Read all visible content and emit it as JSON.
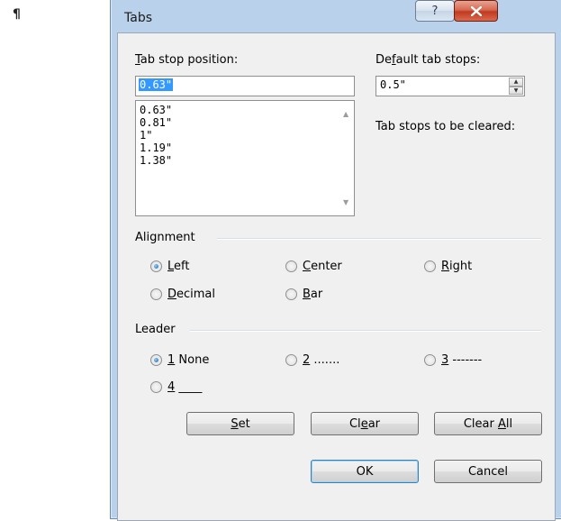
{
  "background_mark": "¶",
  "dialog": {
    "title": "Tabs",
    "help_glyph": "?",
    "tab_stop": {
      "label_pre": "",
      "label_accel": "T",
      "label_post": "ab stop position:",
      "value": "0.63\"",
      "list": [
        "0.63\"",
        "0.81\"",
        "1\"",
        "1.19\"",
        "1.38\""
      ]
    },
    "default_tabs": {
      "label_pre": "De",
      "label_accel": "f",
      "label_post": "ault tab stops:",
      "value": "0.5\""
    },
    "to_clear_label": "Tab stops to be cleared:",
    "alignment": {
      "title": "Alignment",
      "options": [
        {
          "pre": "",
          "accel": "L",
          "post": "eft",
          "checked": true
        },
        {
          "pre": "",
          "accel": "C",
          "post": "enter",
          "checked": false
        },
        {
          "pre": "",
          "accel": "R",
          "post": "ight",
          "checked": false
        },
        {
          "pre": "",
          "accel": "D",
          "post": "ecimal",
          "checked": false
        },
        {
          "pre": "",
          "accel": "B",
          "post": "ar",
          "checked": false
        }
      ]
    },
    "leader": {
      "title": "Leader",
      "options": [
        {
          "accel": "1",
          "post": " None",
          "checked": true
        },
        {
          "accel": "2",
          "post": " .......",
          "checked": false
        },
        {
          "accel": "3",
          "post": " -------",
          "checked": false
        },
        {
          "accel": "4",
          "post": " ____",
          "checked": false
        }
      ]
    },
    "buttons": {
      "set": {
        "pre": "",
        "accel": "S",
        "post": "et"
      },
      "clear": {
        "pre": "Cl",
        "accel": "e",
        "post": "ar"
      },
      "clear_all": {
        "pre": "Clear ",
        "accel": "A",
        "post": "ll"
      },
      "ok": "OK",
      "cancel": "Cancel"
    }
  }
}
